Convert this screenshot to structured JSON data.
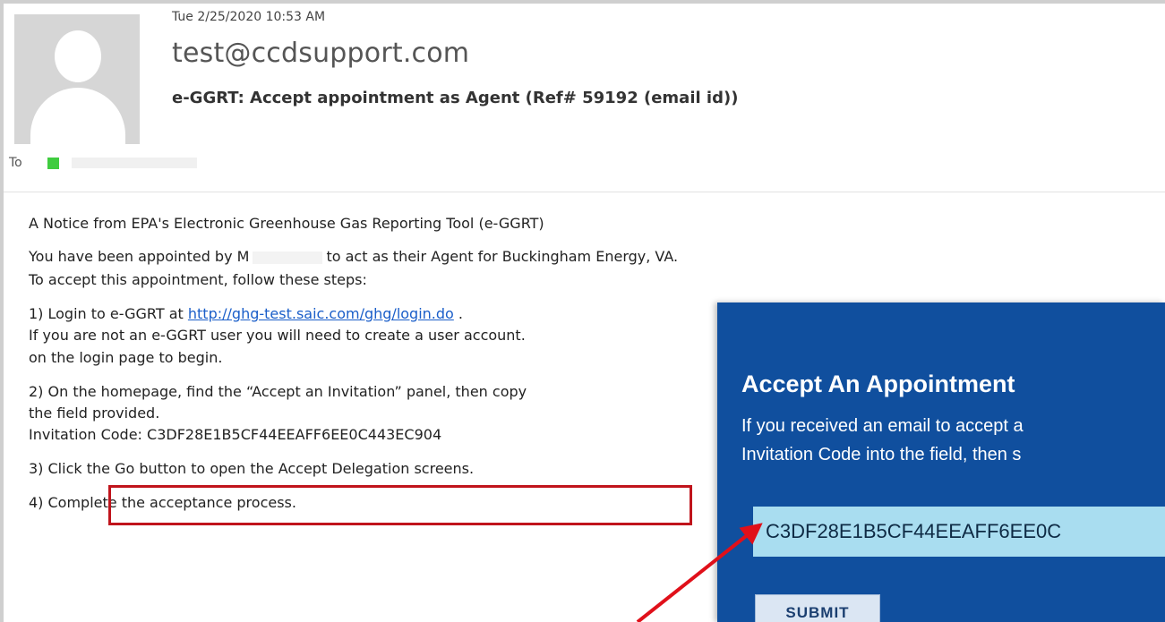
{
  "email": {
    "date": "Tue 2/25/2020 10:53 AM",
    "from": "test@ccdsupport.com",
    "subject": "e-GGRT: Accept appointment as Agent (Ref# 59192 (email id))",
    "to_label": "To"
  },
  "body": {
    "notice": "A Notice from EPA's Electronic Greenhouse Gas Reporting Tool (e-GGRT)",
    "appointed_prefix": "You have been appointed by M",
    "appointed_suffix": "to act as their Agent for Buckingham Energy, VA.",
    "accept_intro": "To accept this appointment, follow these steps:",
    "step1_prefix": "1) Login to e-GGRT at ",
    "step1_link": "http://ghg-test.saic.com/ghg/login.do",
    "step1_suffix": " .",
    "step1_line2": "If you are not an e-GGRT user you will need to create a user account.",
    "step1_line3": "on the login page to begin.",
    "step2_line1": "2) On the homepage, find the “Accept an Invitation” panel, then copy",
    "step2_line2": "the field provided.",
    "invitation_code_line": "Invitation Code: C3DF28E1B5CF44EEAFF6EE0C443EC904",
    "step3": "3) Click the Go button to open the Accept Delegation screens.",
    "step4": "4) Complete the acceptance process."
  },
  "panel": {
    "title": "Accept An Appointment",
    "desc_line1": "If you received an email to accept a",
    "desc_line2": "Invitation Code into the field, then s",
    "code_value": "C3DF28E1B5CF44EEAFF6EE0C",
    "submit_label": "SUBMIT"
  },
  "colors": {
    "panel_bg": "#104f9e",
    "highlight": "#c0141c",
    "link": "#1a5ec9",
    "input_bg": "#a9ddf0"
  }
}
